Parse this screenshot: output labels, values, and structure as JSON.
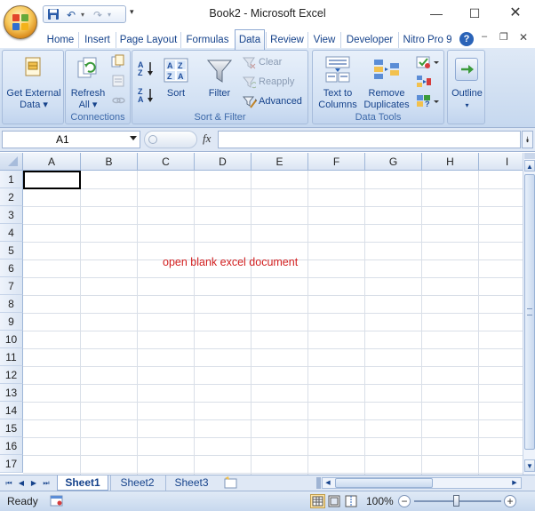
{
  "window": {
    "title": "Book2 - Microsoft Excel"
  },
  "ribbon_tabs": [
    "Home",
    "Insert",
    "Page Layout",
    "Formulas",
    "Data",
    "Review",
    "View",
    "Developer",
    "Nitro Pro 9"
  ],
  "active_tab": "Data",
  "groups": {
    "get_external": {
      "label": "Get External Data",
      "line1": "Get External",
      "line2": "Data"
    },
    "connections": {
      "label": "Connections",
      "refresh_line1": "Refresh",
      "refresh_line2": "All"
    },
    "sort_filter": {
      "label": "Sort & Filter",
      "sort": "Sort",
      "filter": "Filter",
      "clear": "Clear",
      "reapply": "Reapply",
      "advanced": "Advanced"
    },
    "data_tools": {
      "label": "Data Tools",
      "text_to_columns_line1": "Text to",
      "text_to_columns_line2": "Columns",
      "remove_duplicates_line1": "Remove",
      "remove_duplicates_line2": "Duplicates"
    },
    "outline": {
      "label": "Outline"
    }
  },
  "formula_bar": {
    "name_box": "A1",
    "fx": "fx",
    "value": ""
  },
  "grid": {
    "columns": [
      "A",
      "B",
      "C",
      "D",
      "E",
      "F",
      "G",
      "H",
      "I"
    ],
    "rows": [
      "1",
      "2",
      "3",
      "4",
      "5",
      "6",
      "7",
      "8",
      "9",
      "10",
      "11",
      "12",
      "13",
      "14",
      "15",
      "16",
      "17"
    ]
  },
  "annotation": "open blank excel document",
  "sheets": [
    "Sheet1",
    "Sheet2",
    "Sheet3"
  ],
  "active_sheet": "Sheet1",
  "status": {
    "ready": "Ready",
    "zoom": "100%"
  },
  "colors": {
    "accent": "#15428b",
    "annotation": "#d21e1e",
    "ribbon_bg": "#dfe9f6"
  }
}
